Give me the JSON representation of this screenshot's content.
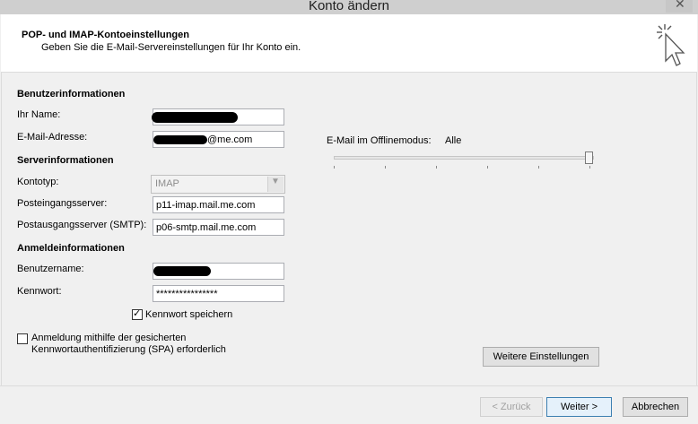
{
  "window": {
    "title": "Konto ändern"
  },
  "header": {
    "title": "POP- und IMAP-Kontoeinstellungen",
    "subtitle": "Geben Sie die E-Mail-Servereinstellungen für Ihr Konto ein."
  },
  "user_info": {
    "heading": "Benutzerinformationen",
    "name_label": "Ihr Name:",
    "email_label": "E-Mail-Adresse:",
    "email_value": "@me.com"
  },
  "server_info": {
    "heading": "Serverinformationen",
    "account_type_label": "Kontotyp:",
    "account_type_value": "IMAP",
    "incoming_label": "Posteingangsserver:",
    "incoming_value": "p11-imap.mail.me.com",
    "outgoing_label": "Postausgangsserver (SMTP):",
    "outgoing_value": "p06-smtp.mail.me.com"
  },
  "login_info": {
    "heading": "Anmeldeinformationen",
    "username_label": "Benutzername:",
    "password_label": "Kennwort:",
    "password_value": "****************",
    "remember_password_label": "Kennwort speichern",
    "remember_password_checked": true,
    "spa_label_line1": "Anmeldung mithilfe der gesicherten",
    "spa_label_line2": "Kennwortauthentifizierung (SPA) erforderlich",
    "spa_checked": false
  },
  "offline": {
    "label": "E-Mail im Offlinemodus:",
    "value": "Alle",
    "slider_fraction": 1.0
  },
  "buttons": {
    "more_settings": "Weitere Einstellungen",
    "back": "< Zurück",
    "next": "Weiter >",
    "cancel": "Abbrechen"
  }
}
